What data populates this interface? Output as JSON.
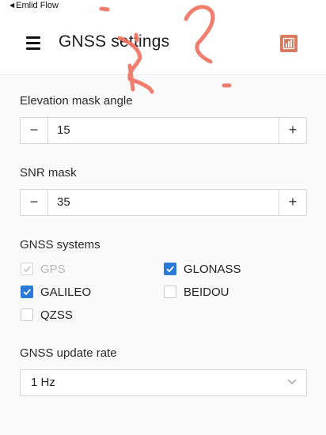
{
  "status_bar": {
    "back_label": "Emlid Flow"
  },
  "header": {
    "title": "GNSS settings",
    "menu_icon": "hamburger-menu-icon",
    "chart_icon": "bar-chart-icon",
    "accent_color": "#d9795d"
  },
  "elevation_mask": {
    "label": "Elevation mask angle",
    "value": "15",
    "minus": "−",
    "plus": "+"
  },
  "snr_mask": {
    "label": "SNR mask",
    "value": "35",
    "minus": "−",
    "plus": "+"
  },
  "gnss_systems": {
    "label": "GNSS systems",
    "items": [
      {
        "name": "GPS",
        "checked": true,
        "disabled": true
      },
      {
        "name": "GLONASS",
        "checked": true,
        "disabled": false
      },
      {
        "name": "GALILEO",
        "checked": true,
        "disabled": false
      },
      {
        "name": "BEIDOU",
        "checked": false,
        "disabled": false
      },
      {
        "name": "QZSS",
        "checked": false,
        "disabled": false
      }
    ],
    "check_color": "#2a7ad9"
  },
  "update_rate": {
    "label": "GNSS update rate",
    "value": "1 Hz",
    "chevron_icon": "chevron-down-icon"
  }
}
